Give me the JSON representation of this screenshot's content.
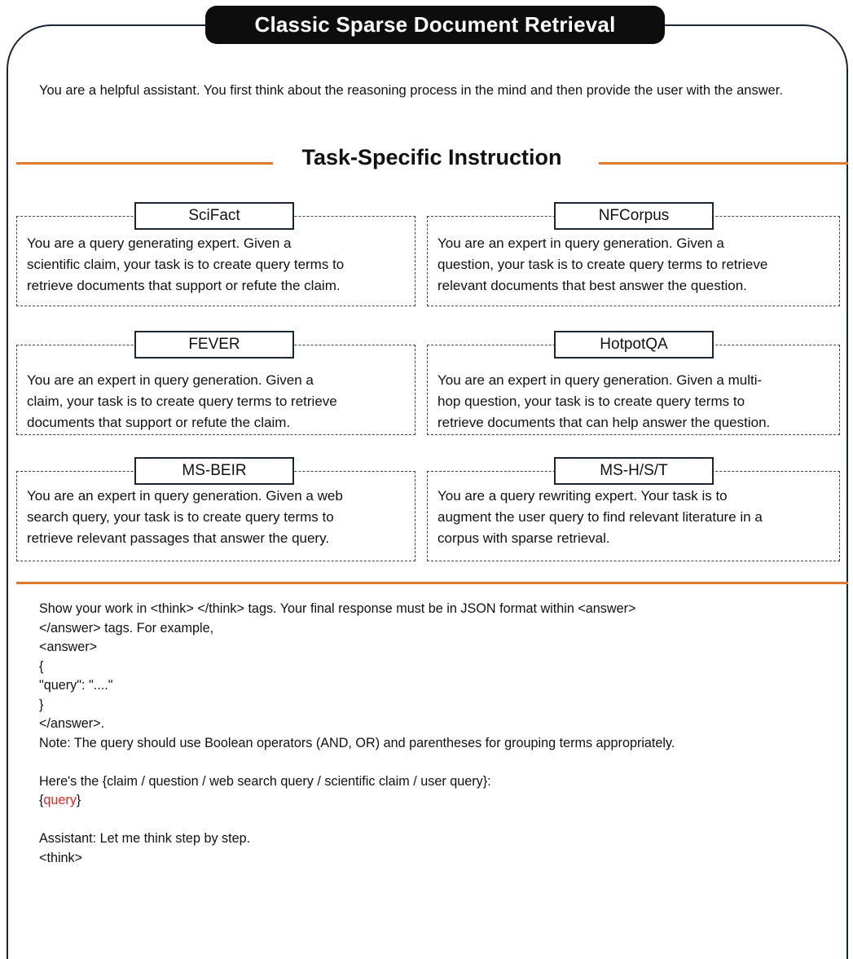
{
  "title": "Classic Sparse Document Retrieval",
  "system_prompt": "You are a helpful assistant. You first think about the reasoning process in the mind and then provide the user with the answer.",
  "section_heading": "Task-Specific Instruction",
  "tasks": [
    {
      "label": "SciFact",
      "lines": [
        "You are a query generating expert. Given a",
        "scientific claim, your task is to create query terms to",
        "retrieve documents that support or refute the claim."
      ]
    },
    {
      "label": "NFCorpus",
      "lines": [
        "You are an expert in query generation. Given a",
        "question, your task is to create query terms to retrieve",
        "relevant documents that best answer the question."
      ]
    },
    {
      "label": "FEVER",
      "lines": [
        "You are an expert in query generation. Given a",
        "claim, your task is to create query terms to retrieve",
        "documents that support or refute the claim."
      ]
    },
    {
      "label": "HotpotQA",
      "lines": [
        "You are an expert in query generation. Given a multi-",
        "hop question, your task is to create query terms to",
        "retrieve documents that can help answer the question."
      ]
    },
    {
      "label": "MS-BEIR",
      "lines": [
        "You are an expert in query generation. Given a web",
        "search query, your task is to create query terms to",
        "retrieve relevant passages that answer the query."
      ]
    },
    {
      "label": "MS-H/S/T",
      "lines": [
        "You are a query rewriting expert. Your task is to",
        "augment the user query to find relevant literature in a",
        "corpus with sparse retrieval."
      ]
    }
  ],
  "footer": {
    "l1": "Show your work in <think> </think> tags. Your final response must be in JSON format within <answer>",
    "l2": "</answer> tags. For example,",
    "l3": "<answer>",
    "l4": "{",
    "l5": "\"query\": \"....\"",
    "l6": "}",
    "l7": "</answer>.",
    "l8": "Note: The query should use Boolean operators (AND, OR) and parentheses for grouping terms appropriately.",
    "l9": "Here's the {claim / question / web search query / scientific claim / user query}:",
    "l10_open": "{",
    "l10_query": "query",
    "l10_close": "}",
    "l11": "Assistant: Let me think step by step.",
    "l12": "<think>"
  },
  "colors": {
    "accent_orange": "#e07a2f",
    "title_bg": "#0d0d0d",
    "frame_border": "#1c2535",
    "query_red": "#e32525"
  }
}
